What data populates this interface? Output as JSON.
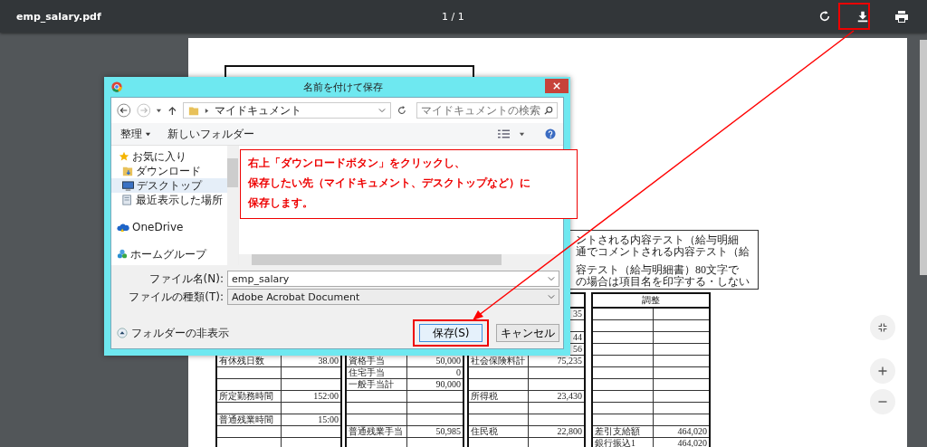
{
  "viewer": {
    "title": "emp_salary.pdf",
    "page_indicator": "1 / 1"
  },
  "document": {
    "comment_lines": [
      "ントされる内容テスト（給与明細",
      "通でコメントされる内容テスト（給",
      "容テスト（給与明細書）80文字で",
      "の場合は項目名を印字する・しない"
    ],
    "tables": [
      {
        "rows": [
          {},
          {},
          {},
          {},
          {
            "label": "有休残日数",
            "value": "38.00"
          },
          {},
          {},
          {
            "label": "所定勤務時間",
            "value": "152:00"
          },
          {},
          {
            "label": "普通残業時間",
            "value": "15:00"
          },
          {},
          {}
        ]
      },
      {
        "rows": [
          {},
          {},
          {},
          {},
          {
            "label": "資格手当",
            "value": "50,000"
          },
          {
            "label": "住宅手当",
            "value": "0"
          },
          {
            "label": "一般手当計",
            "value": "90,000"
          },
          {},
          {},
          {},
          {
            "label": "普通残業手当",
            "value": "50,985"
          },
          {}
        ]
      },
      {
        "rows": [
          {
            "value": "35"
          },
          {},
          {
            "value": "44"
          },
          {
            "value": "56"
          },
          {
            "label": "社会保険料計",
            "value": "75,235"
          },
          {},
          {},
          {
            "label": "所得税",
            "value": "23,430"
          },
          {},
          {},
          {
            "label": "住民税",
            "value": "22,800"
          },
          {}
        ]
      },
      {
        "header": "調整",
        "rows": [
          {},
          {},
          {},
          {},
          {},
          {},
          {},
          {},
          {},
          {},
          {
            "label": "差引支給額",
            "value": "464,020"
          },
          {
            "label": "銀行振込1",
            "value": "464,020"
          }
        ]
      }
    ]
  },
  "dialog": {
    "title": "名前を付けて保存",
    "address": "マイドキュメント",
    "search_placeholder": "マイドキュメントの検索",
    "organize": "整理",
    "new_folder": "新しいフォルダー",
    "nav_items": [
      {
        "label": "お気に入り",
        "kind": "star",
        "selected": false
      },
      {
        "label": "ダウンロード",
        "kind": "download",
        "selected": false
      },
      {
        "label": "デスクトップ",
        "kind": "desktop",
        "selected": true
      },
      {
        "label": "最近表示した場所",
        "kind": "recent",
        "selected": false
      },
      {
        "label": "OneDrive",
        "kind": "cloud",
        "selected": false
      },
      {
        "label": "ホームグループ",
        "kind": "homegroup",
        "selected": false
      }
    ],
    "filename_label": "ファイル名(N):",
    "filename_value": "emp_salary",
    "filetype_label": "ファイルの種類(T):",
    "filetype_value": "Adobe Acrobat Document",
    "hide_folders": "フォルダーの非表示",
    "save": "保存(S)",
    "cancel": "キャンセル"
  },
  "callout": {
    "lines": [
      "右上「ダウンロードボタン」をクリックし、",
      "保存したい先（マイドキュメント、デスクトップなど）に",
      "保存します。"
    ]
  }
}
